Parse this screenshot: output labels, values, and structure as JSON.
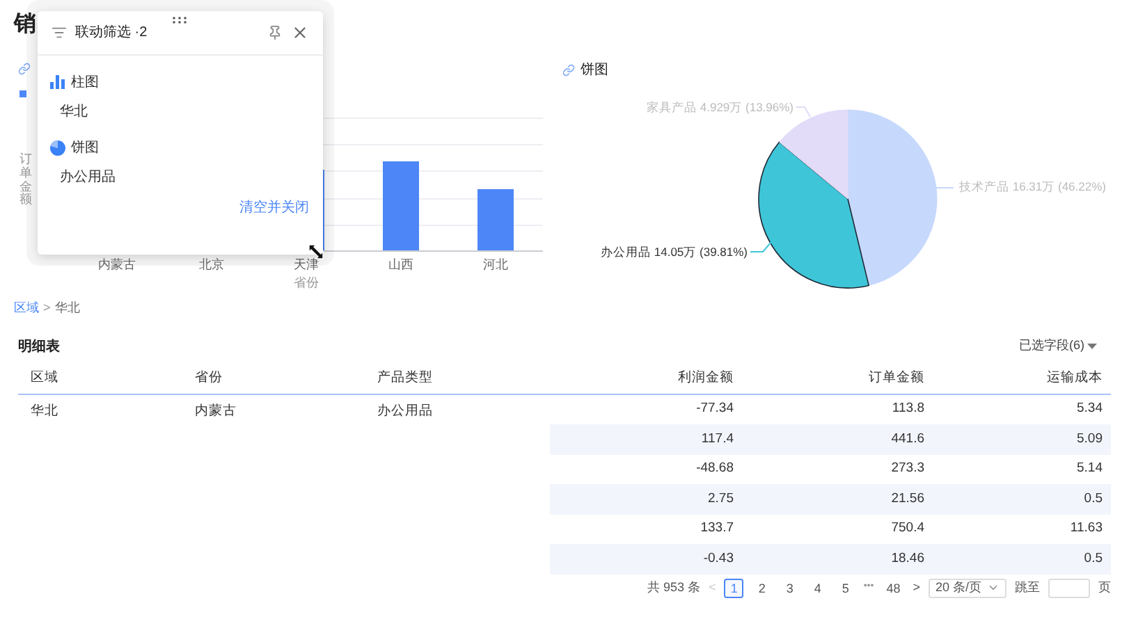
{
  "page": {
    "title": "销"
  },
  "bar_chart": {
    "y_axis_title": "订单金额",
    "x_labels": [
      "内蒙古",
      "北京",
      "天津",
      "山西",
      "河北"
    ],
    "x_axis_title": "省份"
  },
  "breadcrumb": {
    "items": [
      {
        "label": "区域",
        "kind": "link"
      },
      {
        "label": "华北",
        "kind": "current"
      }
    ],
    "separator": ">"
  },
  "pie_chart": {
    "title": "饼图",
    "chart_data": {
      "type": "pie",
      "categories": [
        "技术产品",
        "办公用品",
        "家具产品"
      ],
      "values": [
        16.31,
        14.05,
        4.929
      ],
      "value_labels": [
        "16.31万 (46.22%)",
        "14.05万 (39.81%)",
        "4.929万 (13.96%)"
      ]
    },
    "slices": [
      {
        "color": "#c6d8fc",
        "selected": false
      },
      {
        "color": "#3ec6d8",
        "selected": true
      },
      {
        "color": "#e2dcf8",
        "selected": false
      }
    ]
  },
  "filter_popup": {
    "title": "联动筛选 ·2",
    "filters": [
      {
        "kind": "bar",
        "chart": "柱图",
        "value": "华北"
      },
      {
        "kind": "pie",
        "chart": "饼图",
        "value": "办公用品"
      }
    ],
    "clear_link": "清空并关闭"
  },
  "table": {
    "title": "明细表",
    "field_selector": "已选字段(6)",
    "columns": [
      "区域",
      "省份",
      "产品类型",
      "利润金额",
      "订单金额",
      "运输成本"
    ],
    "groups": [
      {
        "region": "华北",
        "province": "内蒙古",
        "product_type": "办公用品",
        "rows": [
          {
            "profit": "-77.34",
            "order_amount": "113.8",
            "shipping_cost": "5.34"
          },
          {
            "profit": "117.4",
            "order_amount": "441.6",
            "shipping_cost": "5.09"
          },
          {
            "profit": "-48.68",
            "order_amount": "273.3",
            "shipping_cost": "5.14"
          },
          {
            "profit": "2.75",
            "order_amount": "21.56",
            "shipping_cost": "0.5"
          },
          {
            "profit": "133.7",
            "order_amount": "750.4",
            "shipping_cost": "11.63"
          },
          {
            "profit": "-0.43",
            "order_amount": "18.46",
            "shipping_cost": "0.5"
          }
        ]
      }
    ]
  },
  "pagination": {
    "total": "共 953 条",
    "prev": "<",
    "pages": [
      {
        "label": "1",
        "kind": "page",
        "selected": true
      },
      {
        "label": "2",
        "kind": "page",
        "selected": false
      },
      {
        "label": "3",
        "kind": "page",
        "selected": false
      },
      {
        "label": "4",
        "kind": "page",
        "selected": false
      },
      {
        "label": "5",
        "kind": "page",
        "selected": false
      },
      {
        "label": "•••",
        "kind": "ellipsis",
        "selected": false
      },
      {
        "label": "48",
        "kind": "page",
        "selected": false
      }
    ],
    "next": ">",
    "page_size": "20 条/页",
    "jump_label": "跳至",
    "jump_suffix": "页"
  }
}
